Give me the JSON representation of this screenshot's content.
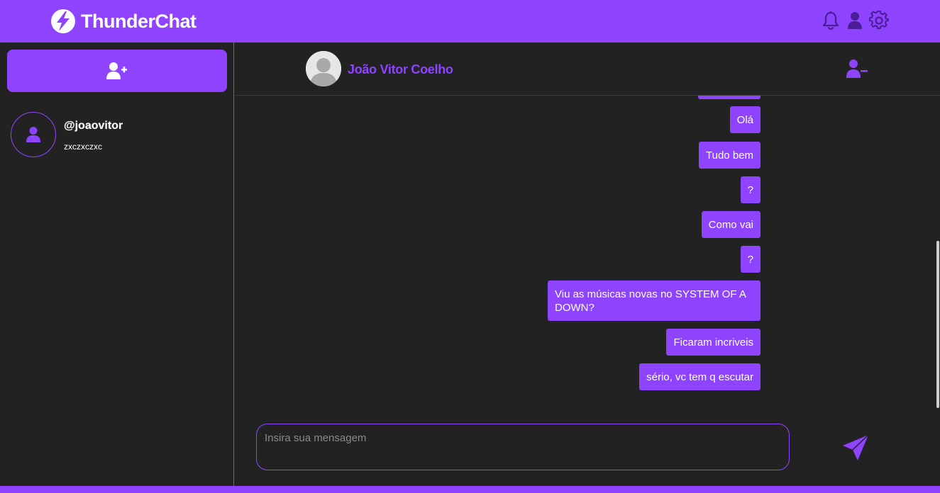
{
  "app": {
    "name": "ThunderChat",
    "accent_color": "#8e44ff",
    "background_color": "#222222"
  },
  "topbar": {
    "logo_icon": "lightning-bolt-icon",
    "icons": [
      "bell-icon",
      "user-icon",
      "gear-icon"
    ]
  },
  "sidebar": {
    "add_contact_icon": "user-plus-icon",
    "contacts": [
      {
        "username": "@joaovitor",
        "last_message": "zxczxczxc",
        "avatar_icon": "user-icon"
      }
    ]
  },
  "chat": {
    "contact_name": "João Vitor Coelho",
    "remove_contact_icon": "user-minus-icon",
    "messages": [
      {
        "text": ""
      },
      {
        "text": "Olá"
      },
      {
        "text": "Tudo bem"
      },
      {
        "text": "?"
      },
      {
        "text": "Como vai"
      },
      {
        "text": "?"
      },
      {
        "text": "Viu as músicas novas no SYSTEM OF A DOWN?"
      },
      {
        "text": "Ficaram incriveis"
      },
      {
        "text": "sério, vc tem q escutar"
      }
    ],
    "composer": {
      "placeholder": "Insira sua mensagem",
      "value": ""
    },
    "send_icon": "paper-plane-icon"
  }
}
